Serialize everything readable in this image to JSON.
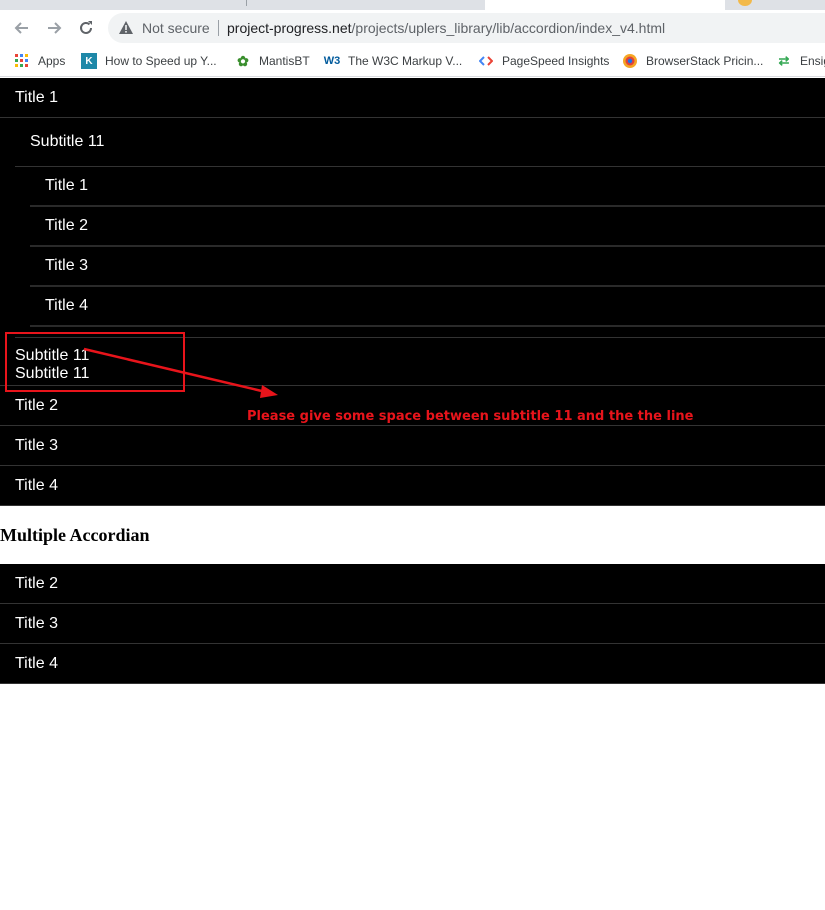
{
  "browser": {
    "security_label": "Not secure",
    "url_host": "project-progress.net",
    "url_path": "/projects/uplers_library/lib/accordion/index_v4.html",
    "nav_icons": [
      "back-arrow-icon",
      "forward-arrow-icon",
      "reload-icon"
    ]
  },
  "bookmarks": [
    {
      "label": "Apps",
      "icon": "apps-grid-icon"
    },
    {
      "label": "How to Speed up Y...",
      "icon": "k-logo-icon"
    },
    {
      "label": "MantisBT",
      "icon": "mantis-icon"
    },
    {
      "label": "The W3C Markup V...",
      "icon": "w3c-icon"
    },
    {
      "label": "PageSpeed Insights",
      "icon": "pagespeed-icon"
    },
    {
      "label": "BrowserStack Pricin...",
      "icon": "browserstack-icon"
    },
    {
      "label": "Ensig",
      "icon": "ensign-icon"
    }
  ],
  "accordion1": {
    "title1": "Title 1",
    "subtitle": "Subtitle 11",
    "nested_items": [
      "Title 1",
      "Title 2",
      "Title 3",
      "Title 4"
    ],
    "sub_block_lines": [
      "Subtitle 11",
      "Subtitle 11"
    ],
    "titles": [
      "Title 2",
      "Title 3",
      "Title 4"
    ]
  },
  "multiple_heading": "Multiple Accordian",
  "accordion2": {
    "titles": [
      "Title 2",
      "Title 3",
      "Title 4"
    ]
  },
  "annotation": {
    "text": "Please give some space between subtitle 11 and the the line",
    "color": "#e8141b"
  }
}
